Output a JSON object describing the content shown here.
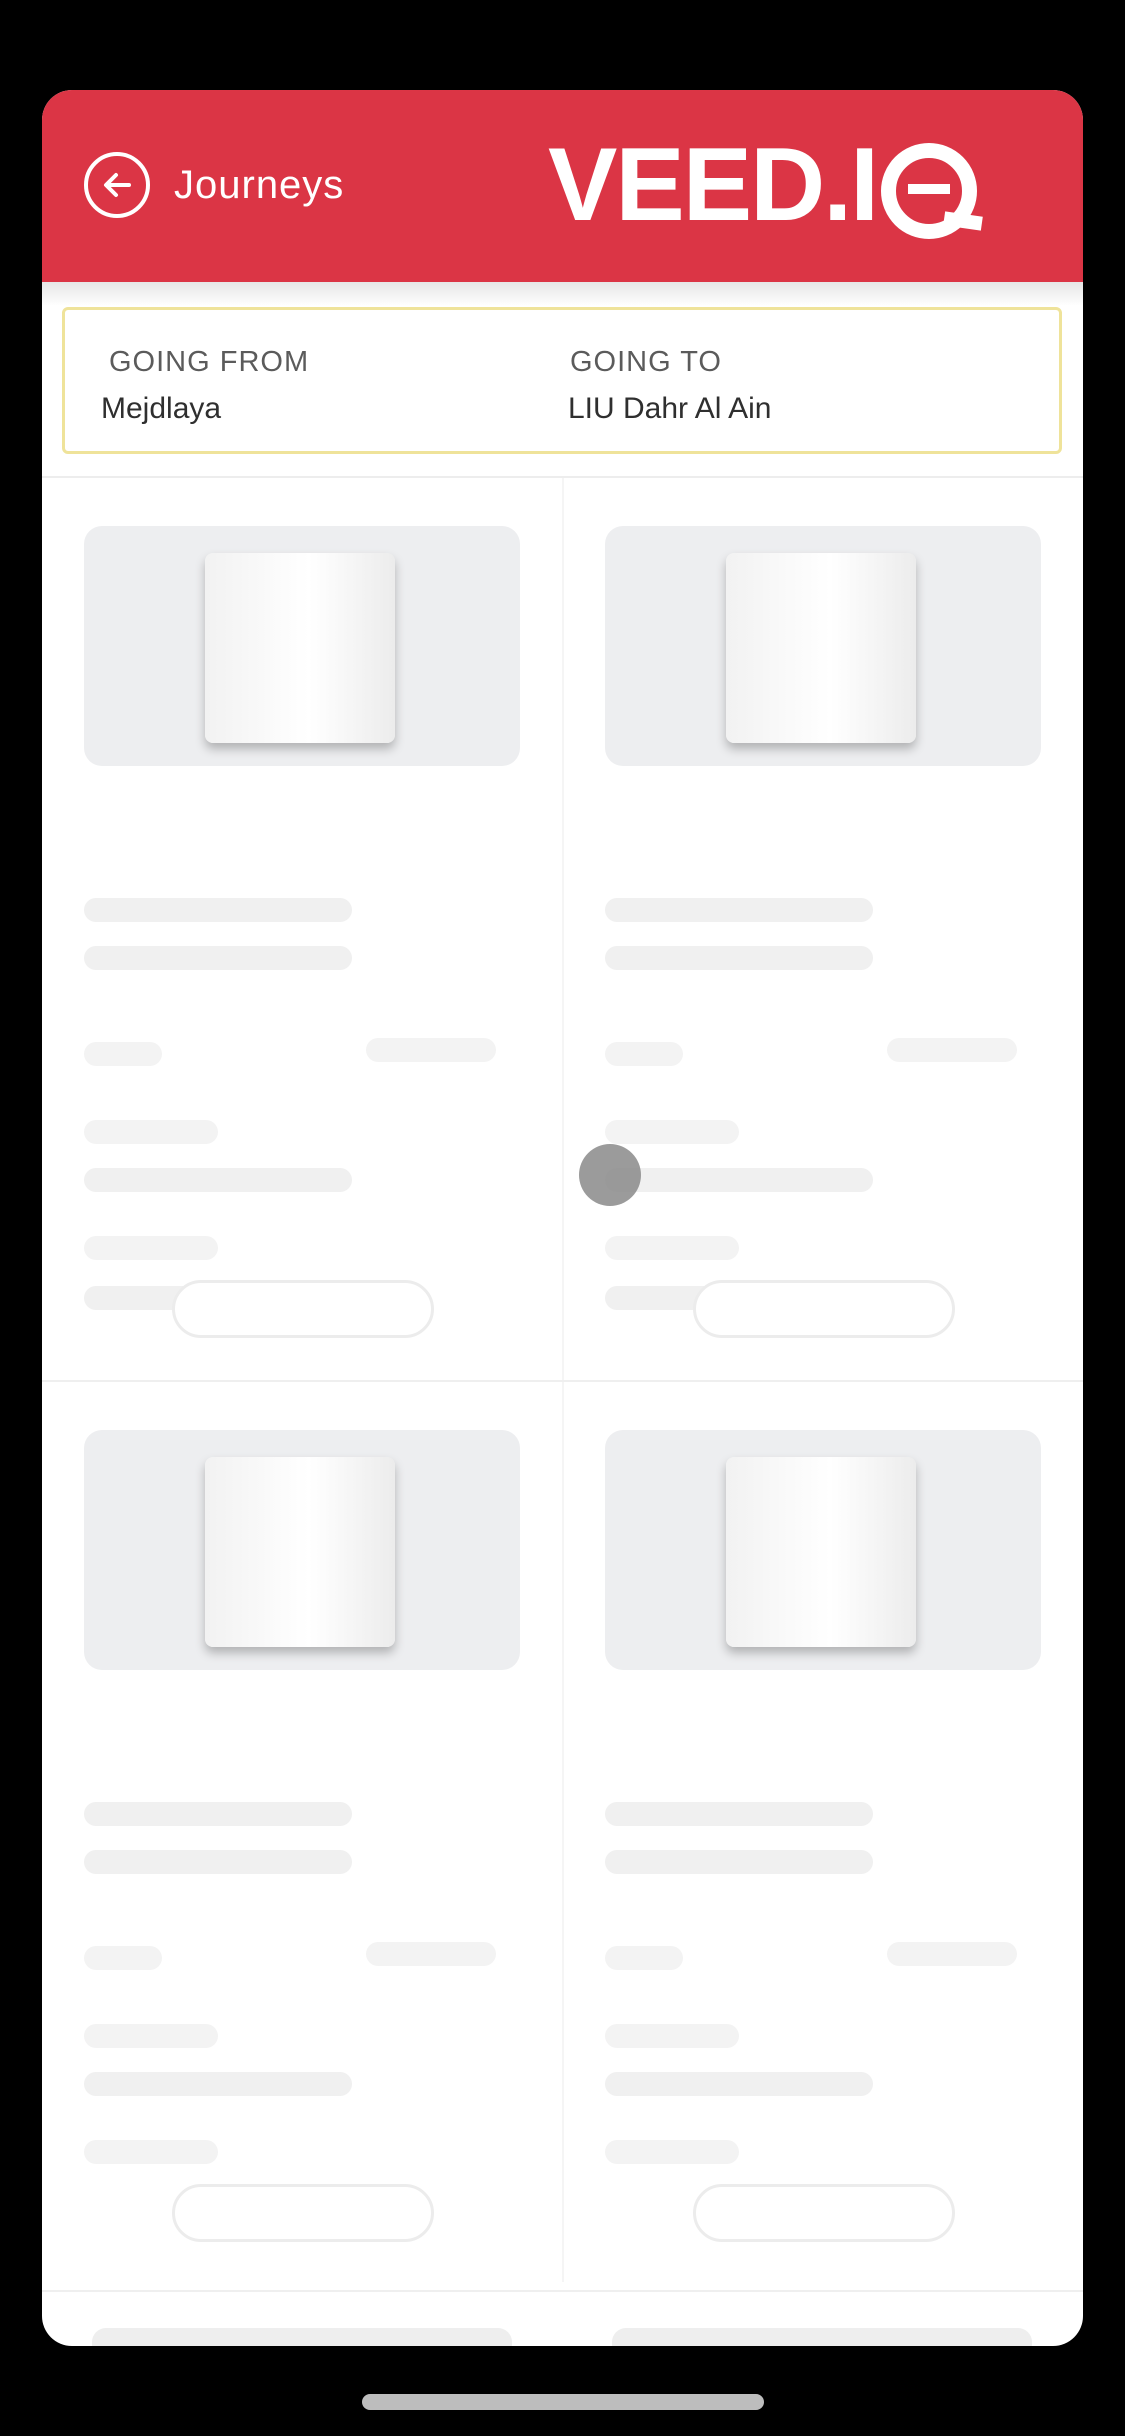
{
  "header": {
    "back_label": "Journeys",
    "brand": "VEED.I",
    "accent_color": "#db3545"
  },
  "route": {
    "from_label": "GOING FROM",
    "from_value": "Mejdlaya",
    "to_label": "GOING TO",
    "to_value": "LIU Dahr Al Ain"
  },
  "icons": {
    "back": "arrow-left-circle-icon"
  }
}
